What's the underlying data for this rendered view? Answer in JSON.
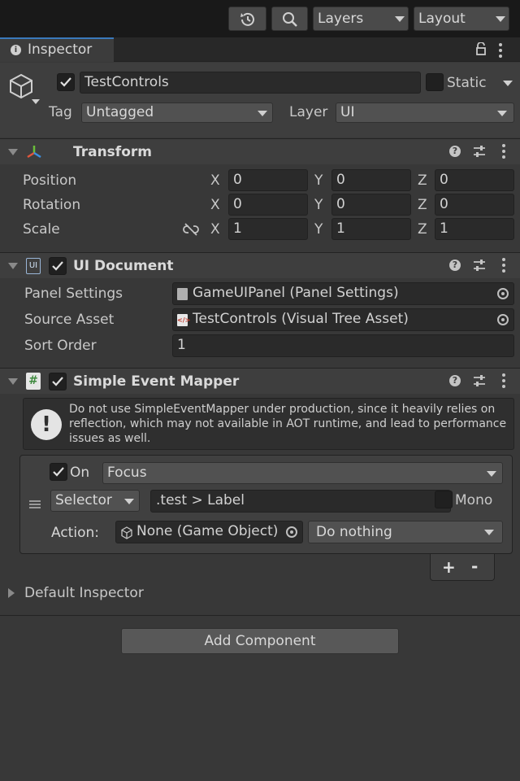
{
  "toolbar": {
    "layers_label": "Layers",
    "layout_label": "Layout"
  },
  "window": {
    "tab_title": "Inspector"
  },
  "gameobject": {
    "name": "TestControls",
    "static_label": "Static",
    "tag_label": "Tag",
    "tag_value": "Untagged",
    "layer_label": "Layer",
    "layer_value": "UI"
  },
  "transform": {
    "title": "Transform",
    "position_label": "Position",
    "rotation_label": "Rotation",
    "scale_label": "Scale",
    "axis_x": "X",
    "axis_y": "Y",
    "axis_z": "Z",
    "position": {
      "x": "0",
      "y": "0",
      "z": "0"
    },
    "rotation": {
      "x": "0",
      "y": "0",
      "z": "0"
    },
    "scale": {
      "x": "1",
      "y": "1",
      "z": "1"
    }
  },
  "ui_document": {
    "icon_text": "UI",
    "title": "UI Document",
    "panel_settings_label": "Panel Settings",
    "panel_settings_value": "GameUIPanel (Panel Settings)",
    "source_asset_label": "Source Asset",
    "source_asset_value": "TestControls (Visual Tree Asset)",
    "sort_order_label": "Sort Order",
    "sort_order_value": "1"
  },
  "event_mapper": {
    "icon_text": "#",
    "title": "Simple Event Mapper",
    "warning": "Do not use SimpleEventMapper under production, since it heavily relies on reflection, which may not available in AOT runtime, and lead to performance issues as well.",
    "on_label": "On",
    "event_value": "Focus",
    "selector_type": "Selector",
    "selector_value": ".test > Label",
    "mono_label": "Mono",
    "action_label": "Action:",
    "target_value": "None (Game Object)",
    "function_value": "Do nothing",
    "add_label": "+",
    "remove_label": "-"
  },
  "default_inspector_label": "Default Inspector",
  "add_component_label": "Add Component"
}
